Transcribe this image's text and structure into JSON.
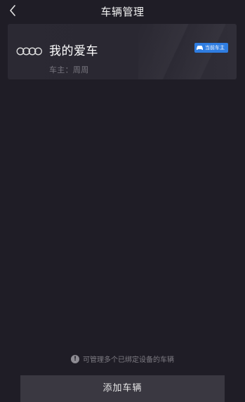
{
  "header": {
    "title": "车辆管理",
    "back_icon": "chevron-left-icon"
  },
  "car": {
    "name": "我的爱车",
    "owner": "车主：周周",
    "logo_icon": "audi-rings-icon",
    "badge_label": "当前车主",
    "badge_icon": "car-icon",
    "badge_color": "#2f7de1"
  },
  "hint": {
    "icon": "info-icon",
    "icon_glyph": "!",
    "text": "可管理多个已绑定设备的车辆"
  },
  "footer": {
    "add_label": "添加车辆"
  },
  "colors": {
    "background": "#1f1d26",
    "card": "#2b2933",
    "button": "#3a3841",
    "accent": "#2f7de1"
  }
}
